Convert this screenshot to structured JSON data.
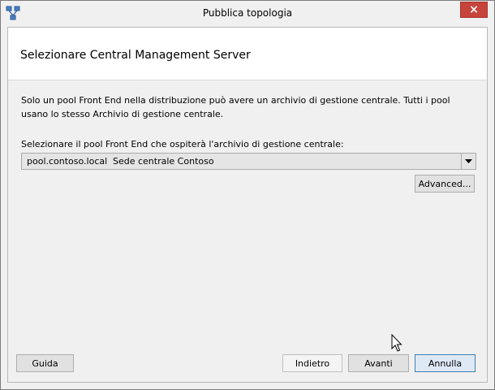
{
  "window": {
    "title": "Pubblica topologia",
    "close_glyph": "×"
  },
  "header": {
    "title": "Selezionare Central Management Server"
  },
  "body": {
    "description": "Solo un pool Front End nella distribuzione può avere un archivio di gestione centrale. Tutti i pool usano lo stesso Archivio di gestione centrale.",
    "select_label": "Selezionare il pool Front End che ospiterà l'archivio di gestione centrale:",
    "pool_select": {
      "value": "pool.contoso.local",
      "site": "Sede centrale Contoso"
    },
    "advanced_label": "Advanced..."
  },
  "footer": {
    "help_label": "Guida",
    "back_label": "Indietro",
    "next_label": "Avanti",
    "cancel_label": "Annulla"
  },
  "icons": {
    "app": "topology-app-icon",
    "dropdown": "chevron-down-icon",
    "cursor": "mouse-pointer-icon"
  },
  "colors": {
    "close_button": "#c7443d",
    "default_button_border": "#3c7fb1",
    "header_background": "#ffffff",
    "window_background": "#f0f0f0"
  }
}
